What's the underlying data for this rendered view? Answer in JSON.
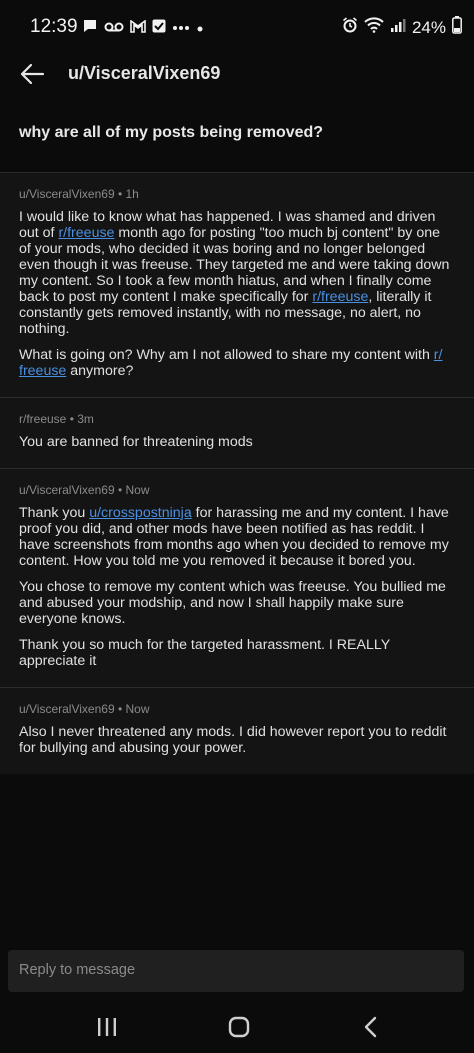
{
  "status_bar": {
    "time": "12:39",
    "battery": "24%",
    "left_icons": [
      "chat-icon",
      "voicemail-icon",
      "gmail-icon",
      "check-icon",
      "dots-icon",
      "dot-icon"
    ],
    "right_icons": [
      "alarm-icon",
      "wifi-icon",
      "signal-icon",
      "battery-icon"
    ]
  },
  "header": {
    "title": "u/VisceralVixen69"
  },
  "subject": "why are all of my posts being removed?",
  "messages": [
    {
      "meta": "u/VisceralVixen69 • 1h",
      "paragraphs": [
        [
          {
            "t": "I would like to know what has happened. I was shamed and driven out of "
          },
          {
            "t": "r/freeuse",
            "link": true
          },
          {
            "t": " month ago for posting \"too much bj content\" by one of your mods, who decided it was boring and no longer belonged even though it was freeuse. They targeted me and were taking down my content. So I took a few month hiatus, and when I finally come back to post my content I make specifically for "
          },
          {
            "t": "r/freeuse",
            "link": true
          },
          {
            "t": ", literally it constantly gets removed instantly, with no message, no alert, no nothing."
          }
        ],
        [
          {
            "t": "What is going on? Why am I not allowed to share my content with "
          },
          {
            "t": "r/ freeuse",
            "link": true
          },
          {
            "t": " anymore?"
          }
        ]
      ]
    },
    {
      "meta": "r/freeuse • 3m",
      "paragraphs": [
        [
          {
            "t": "You are banned for threatening mods"
          }
        ]
      ]
    },
    {
      "meta": "u/VisceralVixen69 • Now",
      "paragraphs": [
        [
          {
            "t": "Thank you "
          },
          {
            "t": "u/crosspostninja",
            "link": true
          },
          {
            "t": " for harassing me and my content. I have proof you did, and other mods have been notified as has reddit. I have screenshots from months ago when you decided to remove my content. How you told me you removed it because it bored you."
          }
        ],
        [
          {
            "t": "You chose to remove my content which was freeuse. You bullied me and abused your modship, and now I shall happily make sure everyone knows."
          }
        ],
        [
          {
            "t": "Thank you so much for the targeted harassment. I REALLY appreciate it"
          }
        ]
      ]
    },
    {
      "meta": "u/VisceralVixen69 • Now",
      "paragraphs": [
        [
          {
            "t": "Also I never threatened any mods. I did however report you to reddit for bullying and abusing your power."
          }
        ]
      ]
    }
  ],
  "reply": {
    "placeholder": "Reply to message"
  },
  "nav": {
    "buttons": [
      "recents-icon",
      "home-icon",
      "back-icon"
    ]
  },
  "colors": {
    "background": "#0b0b0b",
    "card": "#141414",
    "link": "#4a90e2",
    "meta": "#8b8b8b"
  }
}
